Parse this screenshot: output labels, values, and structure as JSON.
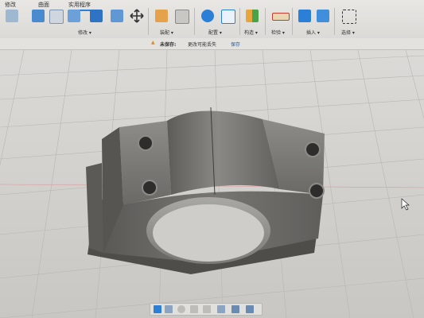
{
  "tabs": [
    "修改",
    "曲面",
    "实用程序"
  ],
  "groups": {
    "modify": "修改 ▾",
    "assemble": "装配 ▾",
    "configure": "配置 ▾",
    "construct": "构造 ▾",
    "inspect": "检验 ▾",
    "insert": "插入 ▾",
    "select": "选择 ▾"
  },
  "notice": {
    "label": "未保存:",
    "message": "更改可能丢失",
    "save": "保存"
  },
  "colors": {
    "accent": "#2b7fd6",
    "model": "#6a6966",
    "grid": "#b8b6b2"
  },
  "icons": [
    "push-pull-icon",
    "fillet-icon",
    "shell-icon",
    "combine-icon",
    "split-icon",
    "move-icon",
    "joint-icon",
    "rigid-group-icon",
    "parameters-icon",
    "table-icon",
    "offset-plane-icon",
    "measure-icon",
    "text-icon",
    "image-icon",
    "select-icon"
  ]
}
